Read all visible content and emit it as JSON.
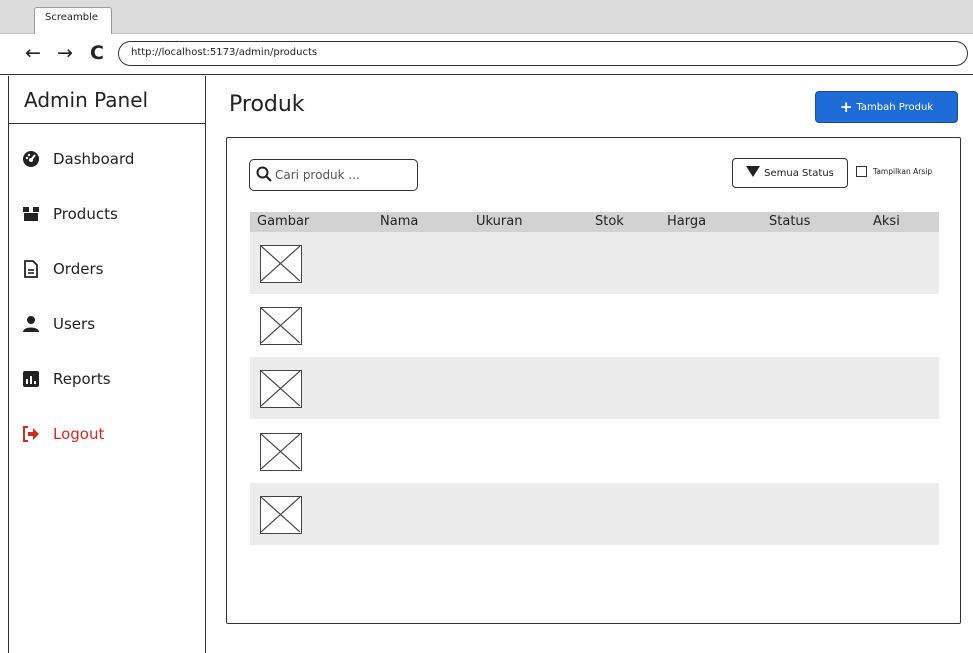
{
  "browser": {
    "tab_title": "Screamble",
    "back_icon": "←",
    "forward_icon": "→",
    "reload_icon": "C",
    "url": "http://localhost:5173/admin/products"
  },
  "sidebar": {
    "title": "Admin Panel",
    "items": [
      {
        "label": "Dashboard",
        "icon": "dashboard-icon"
      },
      {
        "label": "Products",
        "icon": "products-icon"
      },
      {
        "label": "Orders",
        "icon": "orders-icon"
      },
      {
        "label": "Users",
        "icon": "user-icon"
      },
      {
        "label": "Reports",
        "icon": "reports-icon"
      },
      {
        "label": "Logout",
        "icon": "logout-icon"
      }
    ],
    "logout_color": "#d42a22"
  },
  "header": {
    "title": "Produk",
    "add_button": "Tambah Produk",
    "add_button_color": "#1f6bd8"
  },
  "filters": {
    "search_placeholder": "Cari produk ...",
    "status_filter": "Semua Status",
    "archive_label": "Tampilkan Arsip"
  },
  "table": {
    "columns": [
      "Gambar",
      "Nama",
      "Ukuran",
      "Stok",
      "Harga",
      "Status",
      "Aksi"
    ],
    "rows": 5
  }
}
